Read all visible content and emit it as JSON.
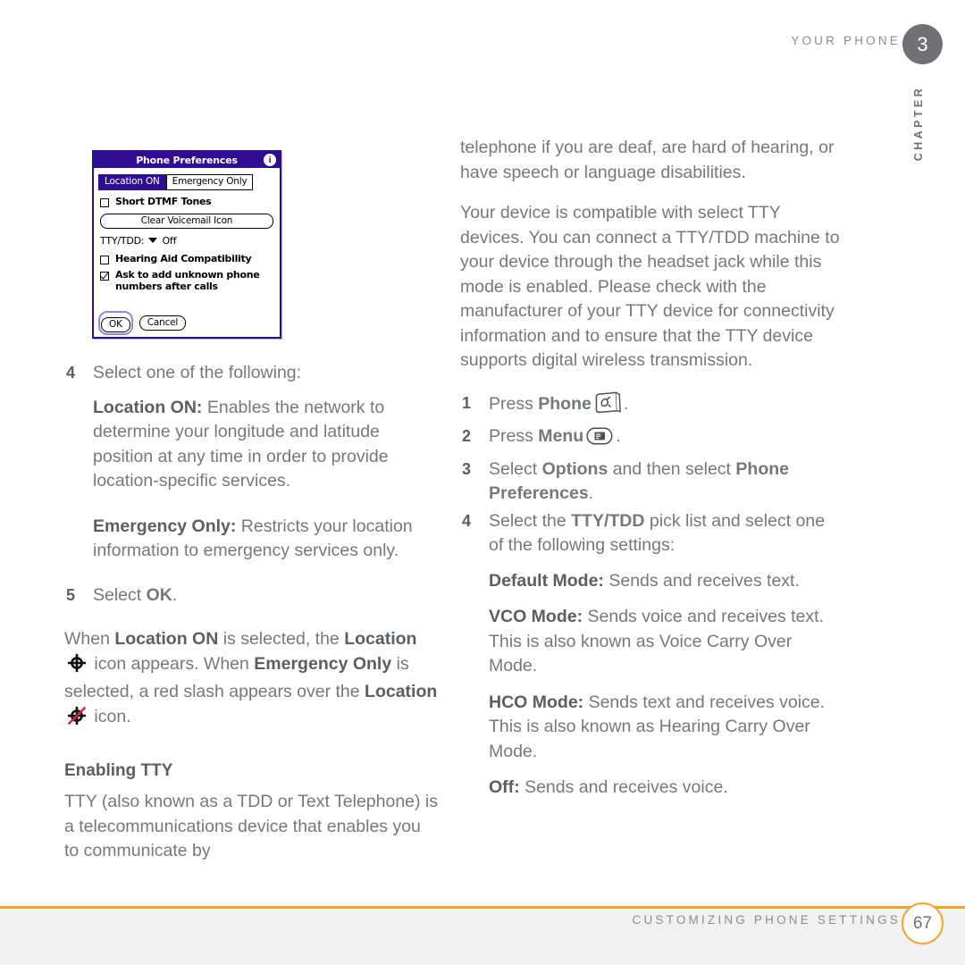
{
  "header": {
    "running_head": "YOUR PHONE",
    "chapter_number": "3",
    "chapter_word": "CHAPTER"
  },
  "footer": {
    "running_foot": "CUSTOMIZING PHONE SETTINGS",
    "page_number": "67"
  },
  "colors": {
    "accent_orange": "#f5a22c",
    "palm_purple": "#2e0d93",
    "text_gray": "#75787b",
    "bold_gray": "#5b5e61",
    "badge_gray": "#6f7174",
    "slash_red": "#d0223c"
  },
  "screenshot": {
    "title": "Phone Preferences",
    "info_icon": "i",
    "segmented": [
      {
        "label": "Location ON",
        "selected": true
      },
      {
        "label": "Emergency Only",
        "selected": false
      }
    ],
    "short_dtmf": {
      "label": "Short DTMF Tones",
      "checked": false
    },
    "clear_voicemail_button": "Clear Voicemail Icon",
    "tty_picklist": {
      "label": "TTY/TDD:",
      "value": "Off"
    },
    "hearing_aid": {
      "label": "Hearing Aid Compatibility",
      "checked": false
    },
    "ask_add_unknown": {
      "line1": "Ask to add unknown phone",
      "line2": "numbers after calls",
      "checked": true
    },
    "ok_button": "OK",
    "cancel_button": "Cancel"
  },
  "left_column": {
    "step4": {
      "num": "4",
      "text": "Select one of the following:"
    },
    "location_on": {
      "term": "Location ON:",
      "body": " Enables the network to determine your longitude and latitude position at any time in order to provide location-specific services."
    },
    "emergency_only": {
      "term": "Emergency Only:",
      "body": " Restricts your location information to emergency services only."
    },
    "step5": {
      "num": "5",
      "pre": "Select ",
      "bold": "OK",
      "post": "."
    },
    "location_icon_paragraph": {
      "part1": "When ",
      "b1": "Location ON",
      "part2": " is selected, the ",
      "b2": "Location",
      "part3": " icon appears. When ",
      "b3": "Emergency Only",
      "part4": " is selected, a red slash appears over the ",
      "b4": "Location",
      "part5": " icon."
    },
    "heading": "Enabling TTY",
    "tty_paragraph": "TTY (also known as a TDD or Text Telephone) is a telecommunications device that enables you to communicate by"
  },
  "right_column": {
    "para1": "telephone if you are deaf, are hard of hearing, or have speech or language disabilities.",
    "para2": "Your device is compatible with select TTY devices. You can connect a TTY/TDD machine to your device through the headset jack while this mode is enabled. Please check with the manufacturer of your TTY device for connectivity information and to ensure that the TTY device supports digital wireless transmission.",
    "step1": {
      "num": "1",
      "pre": "Press ",
      "bold": "Phone",
      "post": "."
    },
    "step2": {
      "num": "2",
      "pre": "Press ",
      "bold": "Menu",
      "post": "."
    },
    "step3": {
      "num": "3",
      "pre": "Select ",
      "b1": "Options",
      "mid": " and then select ",
      "b2": "Phone Preferences",
      "post": "."
    },
    "step4": {
      "num": "4",
      "pre": "Select the ",
      "bold": "TTY/TDD",
      "post": " pick list and select one of the following settings:"
    },
    "default_mode": {
      "term": "Default Mode:",
      "body": " Sends and receives text."
    },
    "vco_mode": {
      "term": "VCO Mode:",
      "body": " Sends voice and receives text. This is also known as Voice Carry Over Mode."
    },
    "hco_mode": {
      "term": "HCO Mode:",
      "body": " Sends text and receives voice. This is also known as Hearing Carry Over Mode."
    },
    "off_mode": {
      "term": "Off:",
      "body": " Sends and receives voice."
    }
  }
}
